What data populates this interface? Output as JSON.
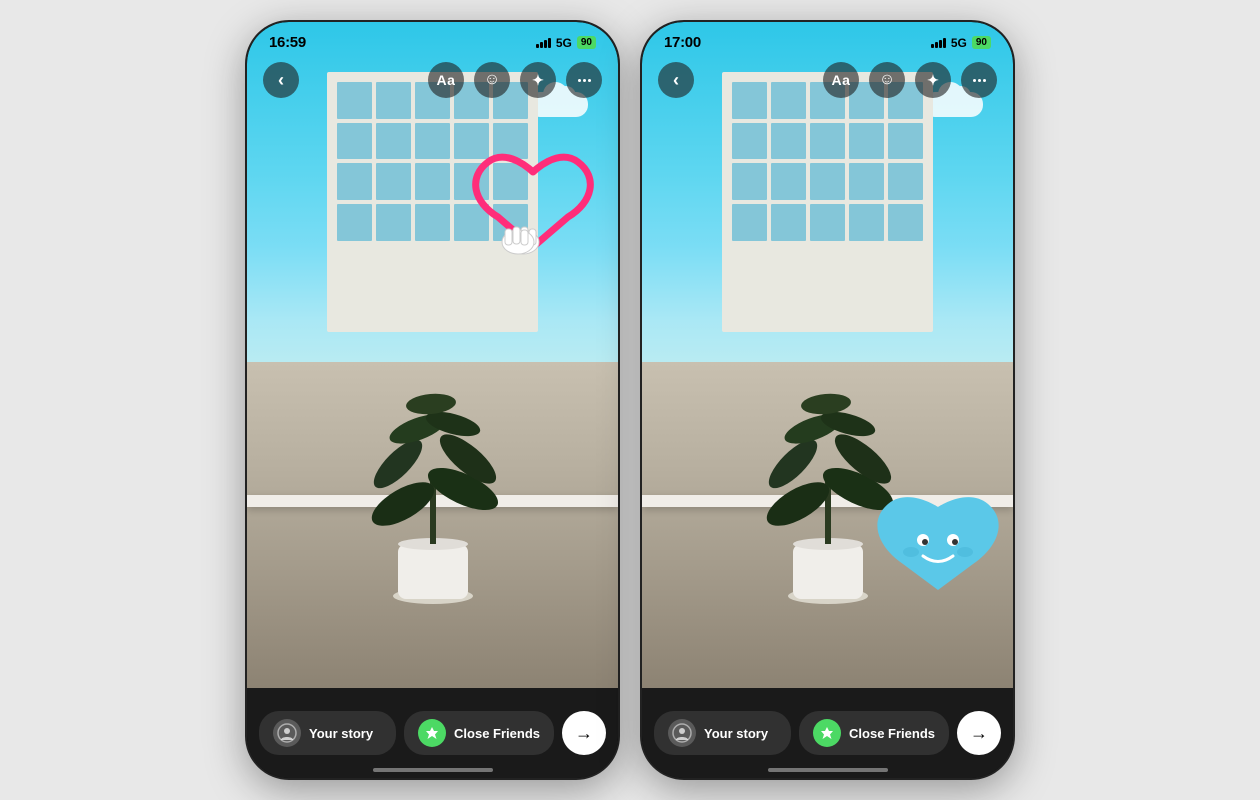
{
  "page": {
    "background": "#e0e0e0"
  },
  "phone1": {
    "status_bar": {
      "time": "16:59",
      "location_icon": "▶",
      "signal": "5G",
      "battery": "90"
    },
    "toolbar": {
      "back_label": "‹",
      "text_label": "Aa",
      "sticker_label": "☺",
      "effects_label": "✦",
      "more_label": "•••"
    },
    "sticker": {
      "type": "heart_drawing",
      "color": "#ff2d7a",
      "description": "Pink heart outline with cartoon hands"
    },
    "bottom_bar": {
      "your_story_label": "Your story",
      "close_friends_label": "Close Friends",
      "send_arrow": "→"
    }
  },
  "phone2": {
    "status_bar": {
      "time": "17:00",
      "signal": "5G",
      "battery": "90"
    },
    "toolbar": {
      "back_label": "‹",
      "text_label": "Aa",
      "sticker_label": "☺",
      "effects_label": "✦",
      "more_label": "•••"
    },
    "sticker": {
      "type": "blue_heart_character",
      "color": "#5bc8e8",
      "description": "Blue heart character with smile face"
    },
    "bottom_bar": {
      "your_story_label": "Your story",
      "close_friends_label": "Close Friends",
      "send_arrow": "→"
    }
  }
}
